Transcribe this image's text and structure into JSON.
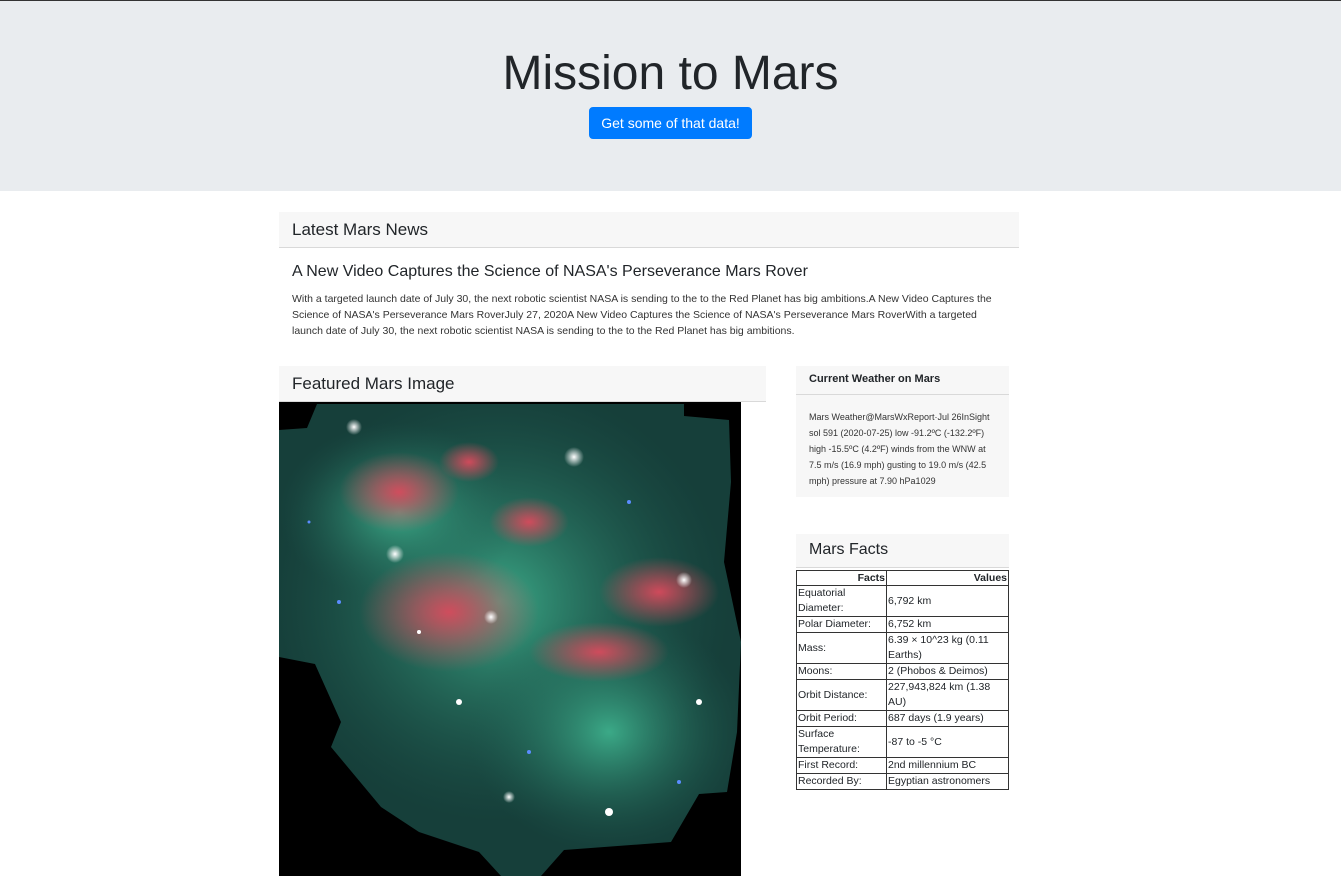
{
  "header": {
    "title": "Mission to Mars",
    "button_label": "Get some of that data!"
  },
  "news": {
    "panel_title": "Latest Mars News",
    "headline": "A New Video Captures the Science of NASA's Perseverance Mars Rover",
    "body": "With a targeted launch date of July 30, the next robotic scientist NASA is sending to the to the Red Planet has big ambitions.A New Video Captures the Science of NASA's Perseverance Mars RoverJuly 27, 2020A New Video Captures the Science of NASA's Perseverance Mars RoverWith a targeted launch date of July 30, the next robotic scientist NASA is sending to the to the Red Planet has big ambitions."
  },
  "featured": {
    "panel_title": "Featured Mars Image"
  },
  "weather": {
    "panel_title": "Current Weather on Mars",
    "text": "Mars Weather@MarsWxReport·Jul 26InSight sol 591 (2020-07-25) low -91.2ºC (-132.2ºF) high -15.5ºC (4.2ºF) winds from the WNW at 7.5 m/s (16.9 mph) gusting to 19.0 m/s (42.5 mph) pressure at 7.90 hPa1029"
  },
  "facts": {
    "panel_title": "Mars Facts",
    "columns": [
      "Facts",
      "Values"
    ],
    "rows": [
      {
        "k": "Equatorial Diameter:",
        "v": "6,792 km"
      },
      {
        "k": "Polar Diameter:",
        "v": "6,752 km"
      },
      {
        "k": "Mass:",
        "v": "6.39 × 10^23 kg (0.11 Earths)"
      },
      {
        "k": "Moons:",
        "v": "2 (Phobos & Deimos)"
      },
      {
        "k": "Orbit Distance:",
        "v": "227,943,824 km (1.38 AU)"
      },
      {
        "k": "Orbit Period:",
        "v": "687 days (1.9 years)"
      },
      {
        "k": "Surface Temperature:",
        "v": "-87 to -5 °C"
      },
      {
        "k": "First Record:",
        "v": "2nd millennium BC"
      },
      {
        "k": "Recorded By:",
        "v": "Egyptian astronomers"
      }
    ]
  }
}
